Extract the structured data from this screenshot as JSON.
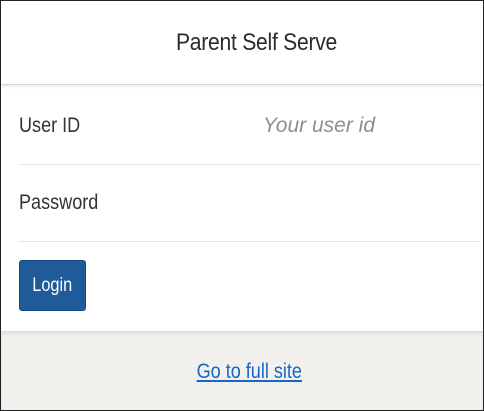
{
  "header": {
    "title": "Parent Self Serve"
  },
  "form": {
    "user_id": {
      "label": "User ID",
      "value": "",
      "placeholder": "Your user id"
    },
    "password": {
      "label": "Password",
      "value": "",
      "placeholder": ""
    },
    "login_label": "Login"
  },
  "footer": {
    "full_site_link": "Go to full site"
  },
  "colors": {
    "button_background": "#1f5a99",
    "link": "#1a66c4",
    "footer_background": "#f1f0ec"
  }
}
